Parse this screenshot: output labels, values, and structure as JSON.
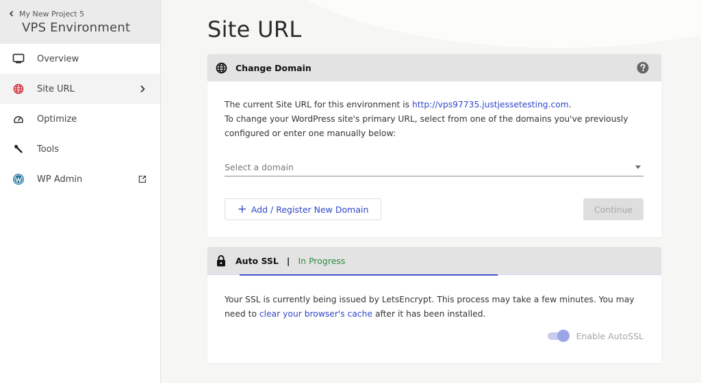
{
  "sidebar": {
    "back_label": "My New Project 5",
    "environment_title": "VPS Environment",
    "items": [
      {
        "label": "Overview",
        "icon": "monitor-icon",
        "active": false
      },
      {
        "label": "Site URL",
        "icon": "globe-icon",
        "active": true
      },
      {
        "label": "Optimize",
        "icon": "speedometer-icon",
        "active": false
      },
      {
        "label": "Tools",
        "icon": "wrench-icon",
        "active": false
      },
      {
        "label": "WP Admin",
        "icon": "wordpress-icon",
        "active": false,
        "external": true
      }
    ]
  },
  "main": {
    "page_title": "Site URL",
    "change_domain": {
      "title": "Change Domain",
      "help_icon": "question-circle-icon",
      "text_prefix": "The current Site URL for this environment is ",
      "current_url": "http://vps97735.justjessetesting.com",
      "text_suffix": ".",
      "instructions": "To change your WordPress site's primary URL, select from one of the domains you've previously configured or enter one manually below:",
      "select_placeholder": "Select a domain",
      "add_button_label": "Add / Register New Domain",
      "continue_button_label": "Continue"
    },
    "auto_ssl": {
      "title": "Auto SSL",
      "separator": "|",
      "status": "In Progress",
      "text_prefix": "Your SSL is currently being issued by LetsEncrypt. This process may take a few minutes. You may need to ",
      "link_text": "clear your browser's cache",
      "text_suffix": " after it has been installed.",
      "toggle_label": "Enable AutoSSL",
      "toggle_enabled": true
    }
  },
  "colors": {
    "accent": "#2f46c8",
    "status_green": "#2e8b3f",
    "globe_red": "#d0343f",
    "wordpress_blue": "#21759b"
  }
}
